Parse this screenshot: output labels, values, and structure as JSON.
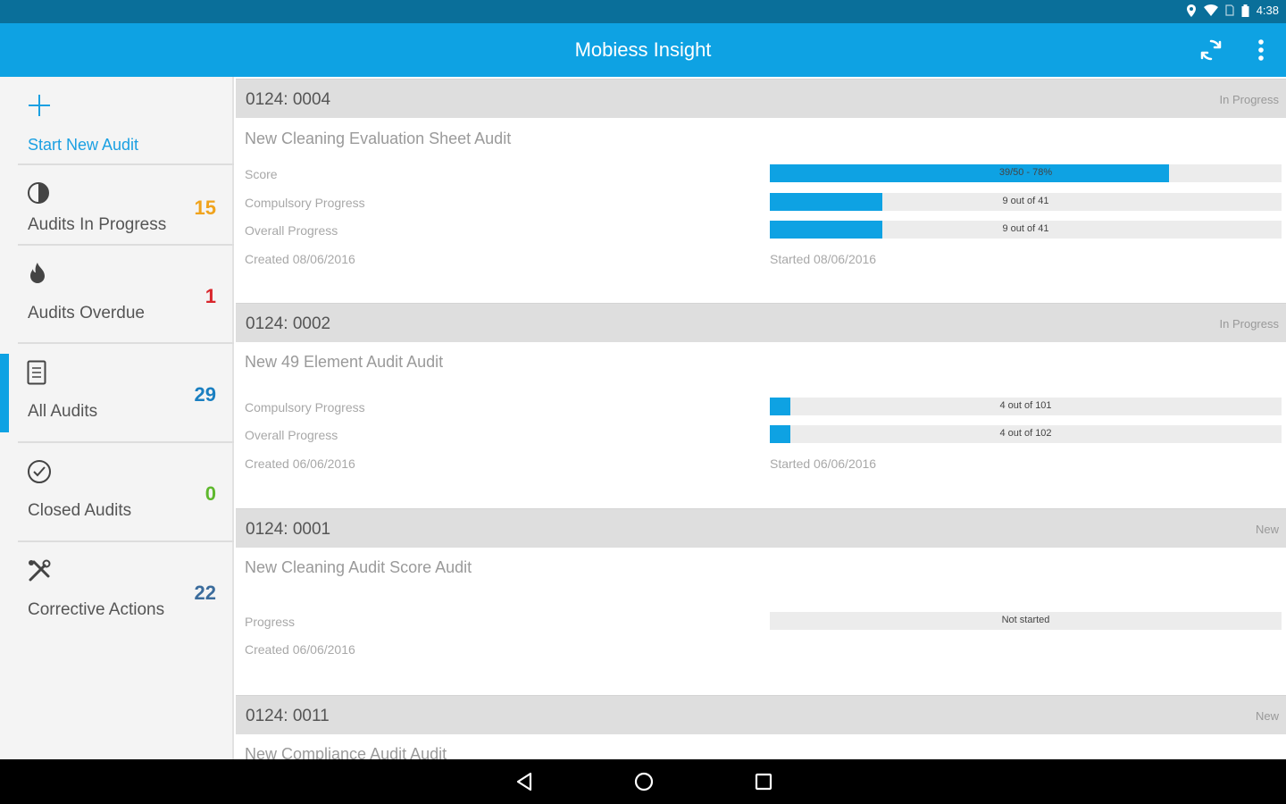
{
  "status_bar": {
    "time": "4:38"
  },
  "app_bar": {
    "title": "Mobiess Insight"
  },
  "sidebar": {
    "start_new": {
      "label": "Start New Audit"
    },
    "items": [
      {
        "label": "Audits In Progress",
        "count": "15",
        "count_color": "#f0a31c"
      },
      {
        "label": "Audits Overdue",
        "count": "1",
        "count_color": "#d9262c"
      },
      {
        "label": "All Audits",
        "count": "29",
        "count_color": "#1a7fc1"
      },
      {
        "label": "Closed Audits",
        "count": "0",
        "count_color": "#5eb82d"
      },
      {
        "label": "Corrective Actions",
        "count": "22",
        "count_color": "#3b6c9c"
      }
    ]
  },
  "audits": [
    {
      "id": "0124: 0004",
      "status": "In Progress",
      "title": "New Cleaning Evaluation Sheet Audit",
      "rows": [
        {
          "label": "Score",
          "bar_text": "39/50 - 78%",
          "fill_fraction": 0.78
        },
        {
          "label": "Compulsory Progress",
          "bar_text": "9 out of 41",
          "fill_fraction": 0.22
        },
        {
          "label": "Overall Progress",
          "bar_text": "9 out of 41",
          "fill_fraction": 0.22
        }
      ],
      "created": "Created 08/06/2016",
      "started": "Started 08/06/2016"
    },
    {
      "id": "0124: 0002",
      "status": "In Progress",
      "title": "New 49 Element Audit Audit",
      "rows": [
        {
          "label": "Compulsory Progress",
          "bar_text": "4 out of 101",
          "fill_fraction": 0.04
        },
        {
          "label": "Overall Progress",
          "bar_text": "4 out of 102",
          "fill_fraction": 0.04
        }
      ],
      "created": "Created 06/06/2016",
      "started": "Started 06/06/2016"
    },
    {
      "id": "0124: 0001",
      "status": "New",
      "title": "New Cleaning Audit Score Audit",
      "rows": [
        {
          "label": "Progress",
          "bar_text": "Not started",
          "fill_fraction": 0
        }
      ],
      "created": "Created 06/06/2016"
    },
    {
      "id": "0124: 0011",
      "status": "New",
      "title": "New Compliance Audit Audit"
    }
  ],
  "colors": {
    "accent": "#0ea2e3",
    "status_bar": "#0a6f9a",
    "header_bg": "#dedede"
  }
}
